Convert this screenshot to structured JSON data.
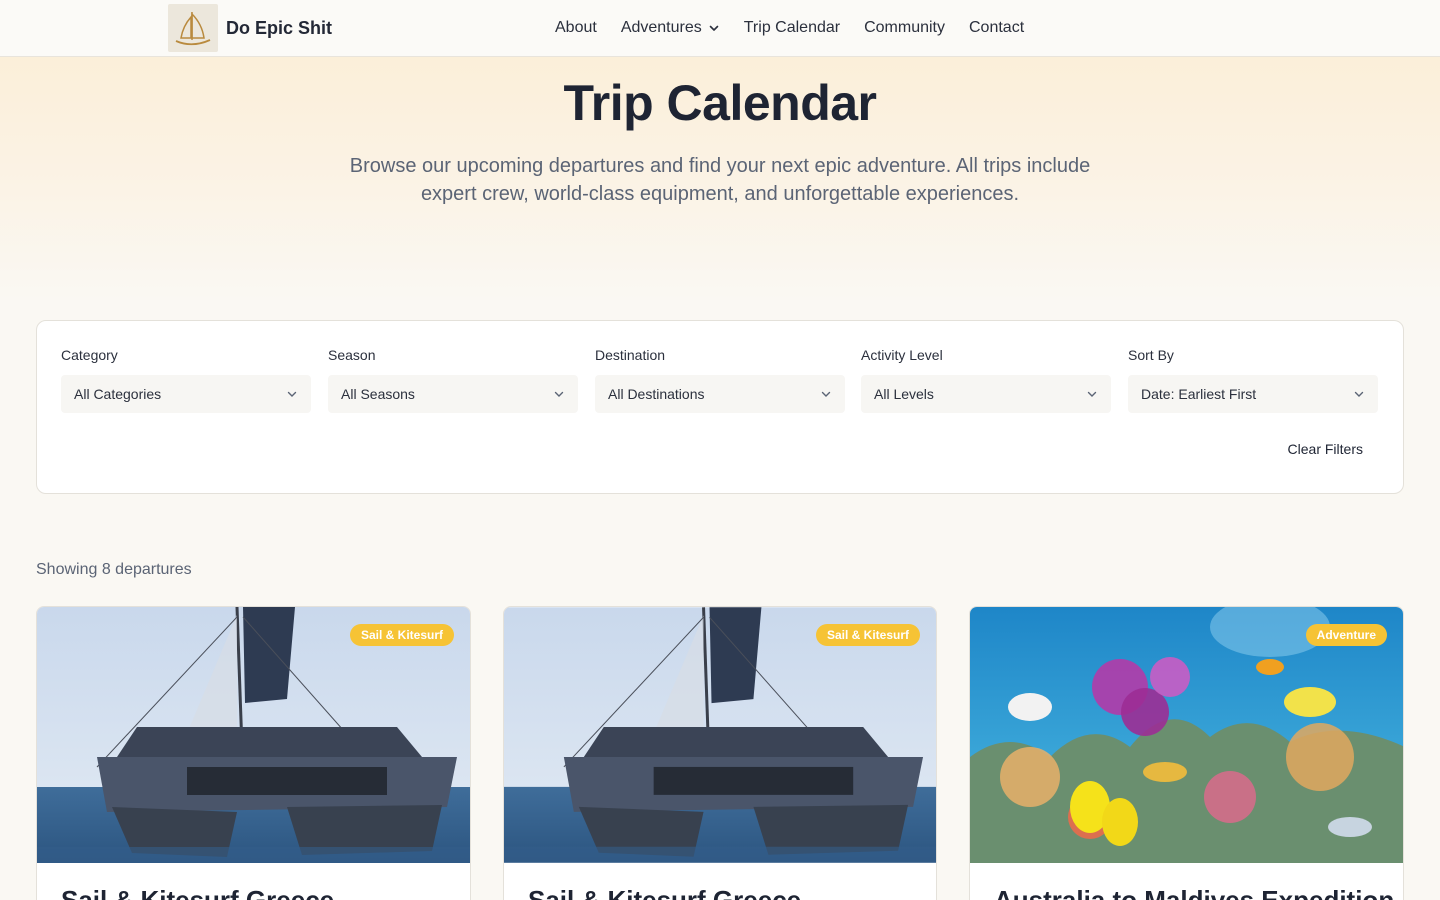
{
  "brand": {
    "name": "Do Epic Shit"
  },
  "nav": {
    "items": [
      "About",
      "Adventures",
      "Trip Calendar",
      "Community",
      "Contact"
    ]
  },
  "hero": {
    "title": "Trip Calendar",
    "subtitle": "Browse our upcoming departures and find your next epic adventure. All trips include expert crew, world-class equipment, and unforgettable experiences."
  },
  "filters": {
    "category": {
      "label": "Category",
      "value": "All Categories"
    },
    "season": {
      "label": "Season",
      "value": "All Seasons"
    },
    "destination": {
      "label": "Destination",
      "value": "All Destinations"
    },
    "activity": {
      "label": "Activity Level",
      "value": "All Levels"
    },
    "sort": {
      "label": "Sort By",
      "value": "Date: Earliest First"
    },
    "clear_label": "Clear Filters"
  },
  "results": {
    "showing": "Showing 8 departures"
  },
  "cards": [
    {
      "badge": "Sail & Kitesurf",
      "title": "Sail & Kitesurf Greece"
    },
    {
      "badge": "Sail & Kitesurf",
      "title": "Sail & Kitesurf Greece"
    },
    {
      "badge": "Adventure",
      "title": "Australia to Maldives Expedition"
    }
  ],
  "colors": {
    "accent": "#f6c335",
    "background": "#faf8f3",
    "text": "#1e2433"
  }
}
